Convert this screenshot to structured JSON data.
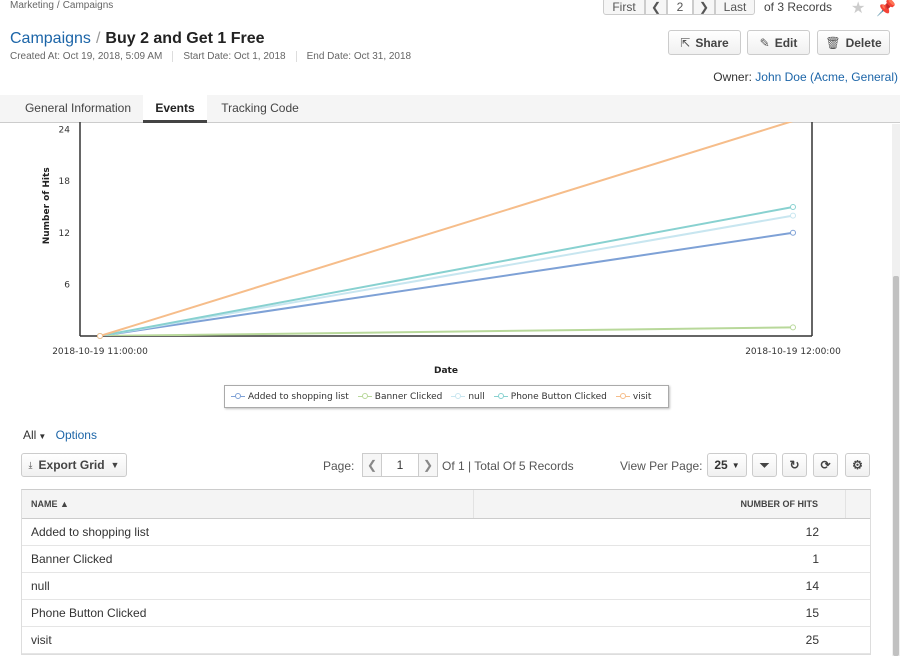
{
  "breadcrumb": [
    "Marketing",
    "Campaigns"
  ],
  "record_pager": {
    "first": "First",
    "page": "2",
    "last": "Last",
    "of_text": "of 3 Records"
  },
  "header": {
    "module": "Campaigns",
    "title": "Buy 2 and Get 1 Free",
    "created": "Created At: Oct 19, 2018, 5:09 AM",
    "start": "Start Date: Oct 1, 2018",
    "end": "End Date: Oct 31, 2018"
  },
  "actions": {
    "share": "Share",
    "edit": "Edit",
    "delete": "Delete"
  },
  "owner": {
    "label": "Owner:",
    "value": "John Doe (Acme, General)"
  },
  "tabs": [
    "General Information",
    "Events",
    "Tracking Code"
  ],
  "active_tab": "Events",
  "chart_data": {
    "type": "line",
    "x": [
      "2018-10-19 11:00:00",
      "2018-10-19 12:00:00"
    ],
    "xlabel": "Date",
    "ylabel": "Number of Hits",
    "yticks": [
      6,
      12,
      18,
      24
    ],
    "ylim": [
      0,
      25
    ],
    "legend": "bottom",
    "series": [
      {
        "name": "Added to shopping list",
        "values": [
          0,
          12
        ],
        "color": "#7ea1d6"
      },
      {
        "name": "Banner Clicked",
        "values": [
          0,
          1
        ],
        "color": "#b8d89a"
      },
      {
        "name": "null",
        "values": [
          0,
          14
        ],
        "color": "#c8e6f0"
      },
      {
        "name": "Phone Button Clicked",
        "values": [
          0,
          15
        ],
        "color": "#88d1d0"
      },
      {
        "name": "visit",
        "values": [
          0,
          25
        ],
        "color": "#f6bd8a"
      }
    ]
  },
  "grid_toolbar": {
    "filter": "All",
    "options": "Options",
    "export": "Export Grid",
    "page_label": "Page:",
    "page": "1",
    "total": "Of 1 | Total Of 5 Records",
    "view_per_page": "View Per Page:",
    "per_page": "25"
  },
  "grid": {
    "columns": [
      "NAME ▲",
      "NUMBER OF HITS"
    ],
    "rows": [
      {
        "name": "Added to shopping list",
        "hits": "12"
      },
      {
        "name": "Banner Clicked",
        "hits": "1"
      },
      {
        "name": "null",
        "hits": "14"
      },
      {
        "name": "Phone Button Clicked",
        "hits": "15"
      },
      {
        "name": "visit",
        "hits": "25"
      }
    ]
  }
}
